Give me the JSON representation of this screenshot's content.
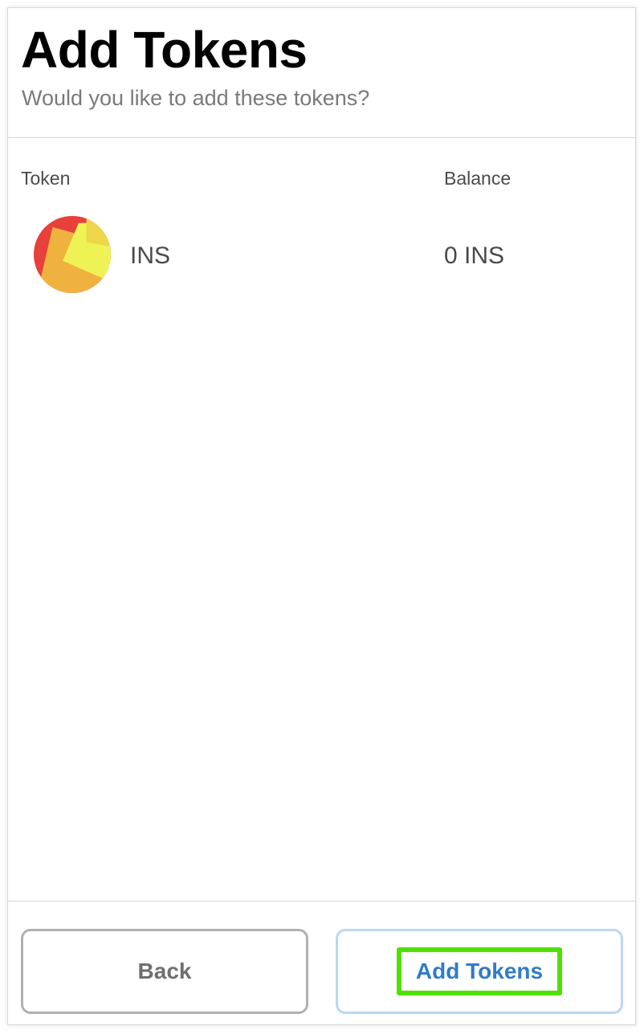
{
  "header": {
    "title": "Add Tokens",
    "subtitle": "Would you like to add these tokens?"
  },
  "table": {
    "columns": {
      "token": "Token",
      "balance": "Balance"
    },
    "rows": [
      {
        "icon": "ins-token-icon",
        "symbol": "INS",
        "balance": "0 INS"
      }
    ]
  },
  "footer": {
    "back_label": "Back",
    "add_label": "Add Tokens"
  },
  "colors": {
    "add_button_text": "#2f7cc9",
    "add_button_border": "#b9d8f3",
    "highlight": "#52e000",
    "back_button_border": "#b0b0b0"
  }
}
